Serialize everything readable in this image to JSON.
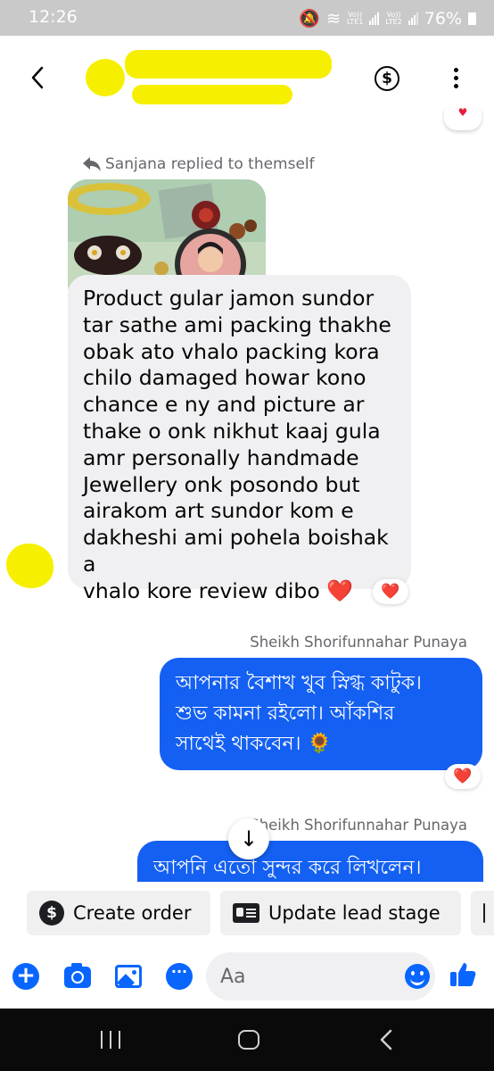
{
  "status_bar": {
    "time": "12:26",
    "sim1": "Vo))\nLTE1",
    "sim2": "Vo))\nLTE2",
    "battery": "76%"
  },
  "header": {
    "icons": [
      "back-arrow-icon",
      "dollar-icon",
      "more-icon"
    ]
  },
  "thread": {
    "reply_note": "Sanjana replied to themself",
    "incoming_message": "Product gular  jamon sundor\ntar sathe ami packing thakhe\nobak ato vhalo packing kora\nchilo damaged howar kono\nchance e ny and picture ar\nthake o onk nikhut kaaj gula\namr personally handmade\nJewellery onk posondo but\nairakom art sundor kom e\ndakheshi ami pohela boishak a\nvhalo kore review dibo",
    "incoming_heart": "❤️",
    "reaction": "❤️",
    "sender1": "Sheikh Shorifunnahar Punaya",
    "outgoing_message_1": "আপনার বৈশাখ খুব স্নিগ্ধ কাটুক।\nশুভ কামনা রইলো। আঁকশির\nসাথেই থাকবেন। 🌻",
    "sender2": "Sheikh Shorifunnahar Punaya",
    "outgoing_message_2": "আপনি এতো সুন্দর করে লিখলেন।",
    "scroll_down": "↓"
  },
  "quick_actions": {
    "create_order": "Create order",
    "update_lead_stage": "Update lead stage"
  },
  "composer": {
    "placeholder": "Aa"
  },
  "colors": {
    "messenger_blue": "#1460f2",
    "incoming_bubble": "#f0f0f2",
    "reaction_red": "#e41e3f",
    "redaction_yellow": "#f6f000"
  }
}
